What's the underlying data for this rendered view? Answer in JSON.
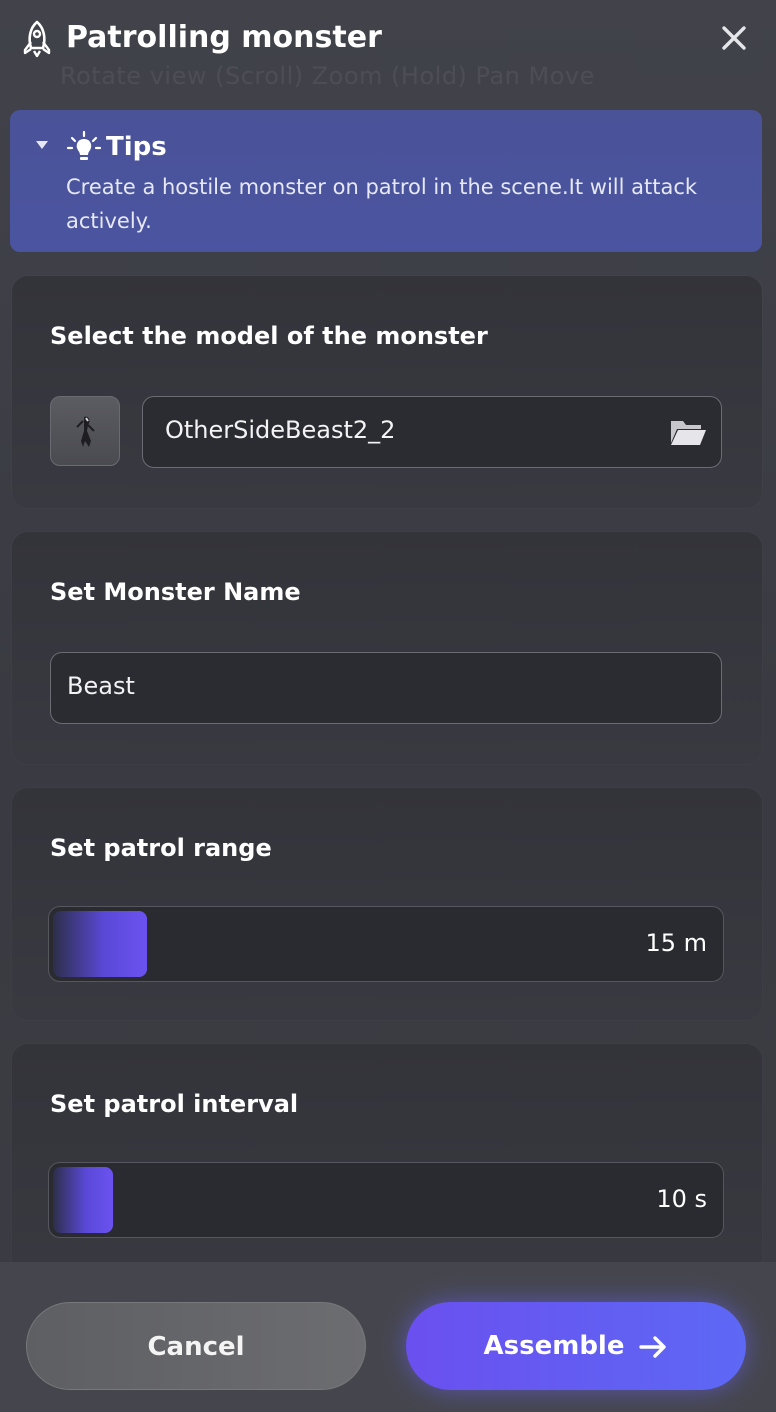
{
  "header": {
    "title": "Patrolling monster",
    "icon": "rocket-icon"
  },
  "background_hint": {
    "text": "Rotate view   (Scroll) Zoom   (Hold) Pan   Move",
    "text2": ""
  },
  "tips": {
    "title": "Tips",
    "text": "Create a hostile monster on patrol in the scene.It will attack actively."
  },
  "model_section": {
    "label": "Select the model of the monster",
    "value": "OtherSideBeast2_2"
  },
  "name_section": {
    "label": "Set Monster Name",
    "value": "Beast"
  },
  "range_section": {
    "label": "Set patrol range",
    "readout": "15 m",
    "value_fraction": 0.14
  },
  "interval_section": {
    "label": "Set patrol interval",
    "readout": "10 s",
    "value_fraction": 0.09
  },
  "footer": {
    "cancel_label": "Cancel",
    "assemble_label": "Assemble"
  },
  "colors": {
    "accent": "#6a50ef",
    "tips_bg": "#4a5398",
    "panel_bg": "#3a3b41"
  }
}
